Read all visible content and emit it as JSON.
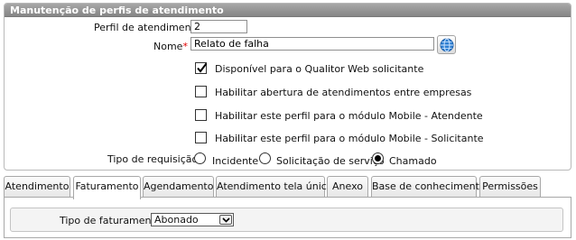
{
  "panel": {
    "title": "Manutenção de perfis de atendimento"
  },
  "form": {
    "perfil_label": "Perfil de atendimento :",
    "perfil_value": "2",
    "nome_label": "Nome",
    "nome_required_mark": "*",
    "nome_colon": " :",
    "nome_value": "Relato de falha",
    "globe_icon": "globe-icon",
    "checkboxes": [
      {
        "label": "Disponível para o Qualitor Web solicitante",
        "checked": true
      },
      {
        "label": "Habilitar abertura de atendimentos entre empresas",
        "checked": false
      },
      {
        "label": "Habilitar este perfil para o módulo Mobile - Atendente",
        "checked": false
      },
      {
        "label": "Habilitar este perfil para o módulo Mobile - Solicitante",
        "checked": false
      }
    ],
    "tipo_requisicao_label": "Tipo de requisição :",
    "radios": [
      {
        "label": "Incidente",
        "selected": false
      },
      {
        "label": "Solicitação de serviço",
        "selected": false
      },
      {
        "label": "Chamado",
        "selected": true
      }
    ]
  },
  "tabs": [
    {
      "label": "Atendimento",
      "active": false
    },
    {
      "label": "Faturamento",
      "active": true
    },
    {
      "label": "Agendamento",
      "active": false
    },
    {
      "label": "Atendimento tela única",
      "active": false
    },
    {
      "label": "Anexo",
      "active": false
    },
    {
      "label": "Base de conhecimento",
      "active": false
    },
    {
      "label": "Permissões",
      "active": false
    }
  ],
  "faturamento": {
    "tipo_label": "Tipo de faturamento :",
    "tipo_value": "Abonado"
  },
  "colors": {
    "header_gradient_top": "#a7a7a7",
    "header_gradient_bottom": "#858585",
    "required": "#e00000",
    "globe_blue": "#2f7fd2"
  }
}
